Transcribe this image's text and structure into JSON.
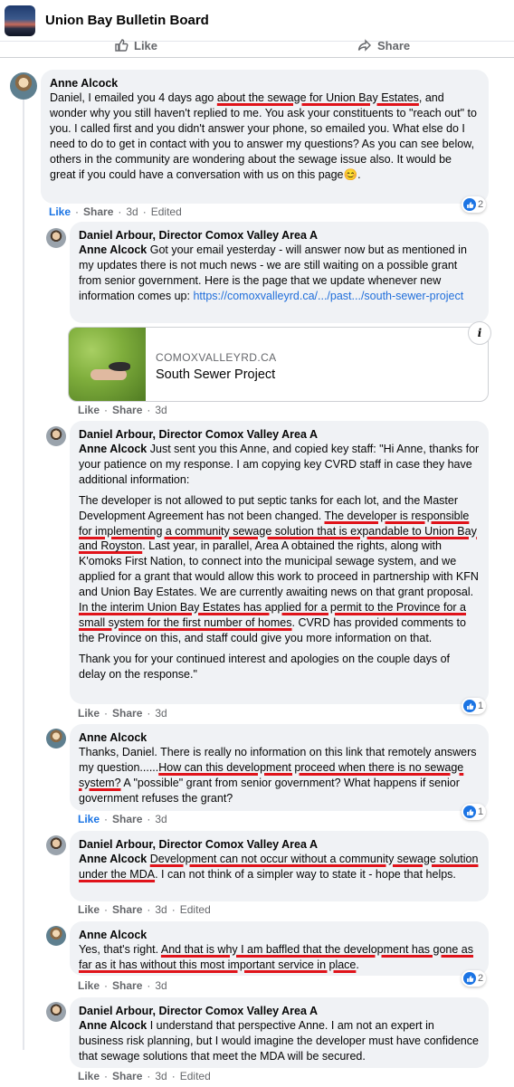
{
  "header": {
    "group_title": "Union Bay Bulletin Board"
  },
  "post_actions": {
    "like": "Like",
    "share": "Share"
  },
  "comments": [
    {
      "author": "Anne Alcock",
      "segments": [
        {
          "t": "Daniel, I emailed you 4 days ago "
        },
        {
          "t": "about the sewage for Union Bay Estates",
          "u": true
        },
        {
          "t": ", and wonder why you still haven't replied to me. You ask your constituents to \"reach out\" to you. I called first and you didn't answer your phone, so emailed you. What else do I need to do to get in contact with you to answer my questions? As you can see below, others in the community are wondering about the sewage issue also. It would be great if you could have a conversation with us on this page😊."
        }
      ],
      "meta": {
        "like": "Like",
        "share": "Share",
        "time": "3d",
        "edited": "Edited"
      },
      "reactions": "2"
    },
    {
      "author": "Daniel Arbour, Director Comox Valley Area A",
      "mention": "Anne Alcock",
      "segments": [
        {
          "t": " Got your email yesterday - will answer now but as mentioned in my updates there is not much news - we are still waiting on a possible grant from senior government. Here is the page that we update whenever new information comes up: "
        },
        {
          "t": "https://comoxvalleyrd.ca/.../past.../south-sewer-project",
          "link": true
        }
      ],
      "link_card": {
        "domain": "COMOXVALLEYRD.CA",
        "title": "South Sewer Project",
        "info": "i"
      },
      "meta": {
        "like": "Like",
        "share": "Share",
        "time": "3d"
      }
    },
    {
      "author": "Daniel Arbour, Director Comox Valley Area A",
      "mention": "Anne Alcock",
      "paragraphs": [
        [
          {
            "t": " Just sent you this Anne, and copied key staff: \"Hi Anne, thanks for your patience on my response. I am copying key CVRD staff in case they have additional information:"
          }
        ],
        [
          {
            "t": "The developer is not allowed to put septic tanks for each lot, and the Master Development Agreement has not been changed. "
          },
          {
            "t": "The developer is responsible for implementing a community sewage solution that is expandable to Union Bay and Royston",
            "u": true
          },
          {
            "t": ". Last year, in parallel, Area A obtained the rights, along with K'omoks First Nation, to connect into the municipal sewage system, and we applied for a grant that would allow this work to proceed in partnership with KFN and Union Bay Estates. We are currently awaiting news on that grant proposal. "
          },
          {
            "t": "In the interim Union Bay Estates has applied for a permit to the Province for a small system for the first number of homes",
            "u": true
          },
          {
            "t": ". CVRD has provided comments to the Province on this, and staff could give you more information on that."
          }
        ],
        [
          {
            "t": "Thank you for your continued interest and apologies on the couple days of delay on the response.\""
          }
        ]
      ],
      "meta": {
        "like": "Like",
        "share": "Share",
        "time": "3d"
      },
      "reactions": "1"
    },
    {
      "author": "Anne Alcock",
      "segments": [
        {
          "t": "Thanks, Daniel. There is really no information on this link that remotely answers my question......"
        },
        {
          "t": "How can this development proceed when there is no sewage system?",
          "u": true
        },
        {
          "t": " A \"possible\" grant from senior government? What happens if senior government refuses the grant?"
        }
      ],
      "meta": {
        "like": "Like",
        "share": "Share",
        "time": "3d"
      },
      "reactions": "1"
    },
    {
      "author": "Daniel Arbour, Director Comox Valley Area A",
      "mention": "Anne Alcock",
      "segments": [
        {
          "t": " "
        },
        {
          "t": "Development can not occur without a community sewage solution under the MDA",
          "u": true
        },
        {
          "t": ". I can not think of a simpler way to state it - hope that helps."
        }
      ],
      "meta": {
        "like": "Like",
        "share": "Share",
        "time": "3d",
        "edited": "Edited"
      }
    },
    {
      "author": "Anne Alcock",
      "segments": [
        {
          "t": "Yes, that's right. "
        },
        {
          "t": "And that is why I am baffled that the development has gone as far as it has without this most important service in place",
          "u": true
        },
        {
          "t": "."
        }
      ],
      "meta": {
        "like": "Like",
        "share": "Share",
        "time": "3d"
      },
      "reactions": "2"
    },
    {
      "author": "Daniel Arbour, Director Comox Valley Area A",
      "mention": "Anne Alcock",
      "segments": [
        {
          "t": " I understand that perspective Anne. I am not an expert in business risk planning, but I would imagine the developer must have confidence that sewage solutions that meet the MDA will be secured."
        }
      ],
      "meta": {
        "like": "Like",
        "share": "Share",
        "time": "3d",
        "edited": "Edited"
      }
    }
  ]
}
